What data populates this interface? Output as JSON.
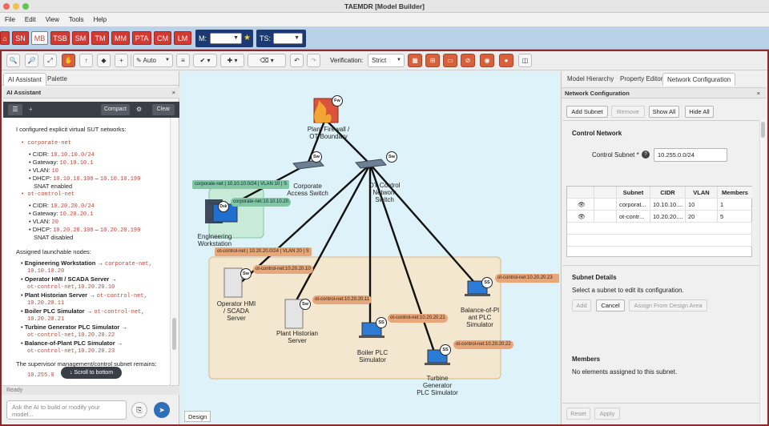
{
  "window": {
    "title": "TAEMDR [Model Builder]"
  },
  "menu": [
    "File",
    "Edit",
    "View",
    "Tools",
    "Help"
  ],
  "modes": [
    "SN",
    "MB",
    "TSB",
    "SM",
    "TM",
    "MM",
    "PTA",
    "CM",
    "LM"
  ],
  "mode_active": "MB",
  "mode_selectors": {
    "m_label": "M:",
    "ts_label": "TS:"
  },
  "toolbar": {
    "auto_label": "Auto",
    "verification_label": "Verification:",
    "verification_value": "Strict"
  },
  "left": {
    "tabs": [
      "AI Assistant",
      "Palette"
    ],
    "panel_title": "AI Assistant",
    "compact_label": "Compact",
    "clear_label": "Clear",
    "chat_intro": "I configured explicit virtual SUT networks:",
    "net1": {
      "name": "corporate-net",
      "cidr_label": "CIDR:",
      "cidr": "10.10.10.0/24",
      "gw_label": "Gateway:",
      "gw": "10.10.10.1",
      "vlan_label": "VLAN:",
      "vlan": "10",
      "dhcp_label": "DHCP:",
      "dhcp_a": "10.10.10.100",
      "dhcp_b": "10.10.10.199",
      "snat": "SNAT enabled"
    },
    "net2": {
      "name": "ot-control-net",
      "cidr_label": "CIDR:",
      "cidr": "10.20.20.0/24",
      "gw_label": "Gateway:",
      "gw": "10.20.20.1",
      "vlan_label": "VLAN:",
      "vlan": "20",
      "dhcp_label": "DHCP:",
      "dhcp_a": "10.20.20.100",
      "dhcp_b": "10.20.20.199",
      "snat": "SNAT disabled"
    },
    "assigned_title": "Assigned launchable nodes:",
    "nodes": [
      {
        "name": "Engineering Workstation",
        "net": "corporate-net,",
        "ip": "10.10.10.20"
      },
      {
        "name": "Operator HMI / SCADA Server",
        "net": "ot-control-net,10.20.20.10",
        "ip": ""
      },
      {
        "name": "Plant Historian Server",
        "net": "ot-control-net,",
        "ip": "10.20.20.11"
      },
      {
        "name": "Boiler PLC Simulator",
        "net": "ot-control-net,",
        "ip": "10.20.20.21"
      },
      {
        "name": "Turbine Generator PLC Simulator",
        "net": "ot-control-net,10.20.20.22",
        "ip": ""
      },
      {
        "name": "Balance-of-Plant PLC Simulator",
        "net": "ot-control-net,10.20.20.23",
        "ip": ""
      }
    ],
    "supervisor_text": "The supervisor management/control subnet remains:",
    "last_mono": "10.255.0",
    "scroll_bottom": "↓ Scroll to bottom",
    "status": "Ready",
    "input_placeholder": "Ask the AI to build or modify your model..."
  },
  "canvas": {
    "tab": "Design",
    "nodes": {
      "firewall": {
        "label1": "Plant Firewall /",
        "label2": "OT Boundary",
        "badge": "Fw"
      },
      "corp_switch": {
        "label1": "Corporate",
        "label2": "Access Switch",
        "badge": "Sw"
      },
      "ot_switch": {
        "label1": "OT Control",
        "label2": "Network",
        "label3": "Switch",
        "badge": "Sw"
      },
      "eng_ws": {
        "label1": "Engineering",
        "label2": "Workstation",
        "badge": "Dsk"
      },
      "hmi": {
        "label1": "Operator HMI",
        "label2": "/ SCADA",
        "label3": "Server",
        "badge": "Sw"
      },
      "historian": {
        "label1": "Plant Historian",
        "label2": "Server",
        "badge": "Sw"
      },
      "boiler": {
        "label1": "Boiler PLC",
        "label2": "Simulator",
        "badge": "SS"
      },
      "turbine": {
        "label1": "Turbine",
        "label2": "Generator",
        "label3": "PLC Simulator",
        "badge": "SS"
      },
      "bop": {
        "label1": "Balance-of-Pl",
        "label2": "ant PLC",
        "label3": "Simulator",
        "badge": "SS"
      }
    },
    "tags": {
      "corp_net": "corporate-net | 10.10.10.0/24 | VLAN 10 | S",
      "corp_ip": "corporate-net:10.10.10.20",
      "ot_net": "ot-control-net | 10.20.20.0/24 | VLAN 20 | S",
      "hmi_ip": "ot-control-net:10.20.20.10",
      "hist_ip": "ot-control-net:10.20.20.11",
      "boiler_ip": "ot-control-net:10.20.20.21",
      "turb_ip": "ot-control-net:10.20.20.22",
      "bop_ip": "ot-control-net:10.20.20.23"
    }
  },
  "right": {
    "tabs": [
      "Model Hierarchy",
      "Property Editor",
      "Network Configuration"
    ],
    "panel_title": "Network Configuration",
    "buttons": [
      "Add Subnet",
      "Remove",
      "Show All",
      "Hide All"
    ],
    "control_network_title": "Control Network",
    "control_subnet_label": "Control Subnet *",
    "control_subnet_value": "10.255.0.0/24",
    "table": {
      "headers": [
        "",
        "",
        "Subnet",
        "CIDR",
        "VLAN",
        "Members"
      ],
      "rows": [
        {
          "subnet": "corporate-net",
          "cidr": "10.10.10.0/24",
          "vlan": "10",
          "members": "1"
        },
        {
          "subnet": "ot-control-net",
          "cidr": "10.20.20.0/24",
          "vlan": "20",
          "members": "5"
        }
      ],
      "subnet_disp": [
        "corporat...",
        "ot-contr..."
      ],
      "cidr_disp": [
        "10.10.10....",
        "10.20.20...."
      ]
    },
    "details_title": "Subnet Details",
    "details_hint": "Select a subnet to edit its configuration.",
    "detail_buttons": [
      "Add",
      "Cancel",
      "Assign From Design Area"
    ],
    "members_title": "Members",
    "members_hint": "No elements assigned to this subnet.",
    "bottom_buttons": [
      "Reset",
      "Apply"
    ]
  },
  "colors": {
    "mode_red": "#d23a32",
    "mode_bar": "#b9d2e8",
    "canvas_bg": "#ddf3f9",
    "tag_green": "#7fc8a3",
    "tag_orange": "#e8a77a"
  }
}
